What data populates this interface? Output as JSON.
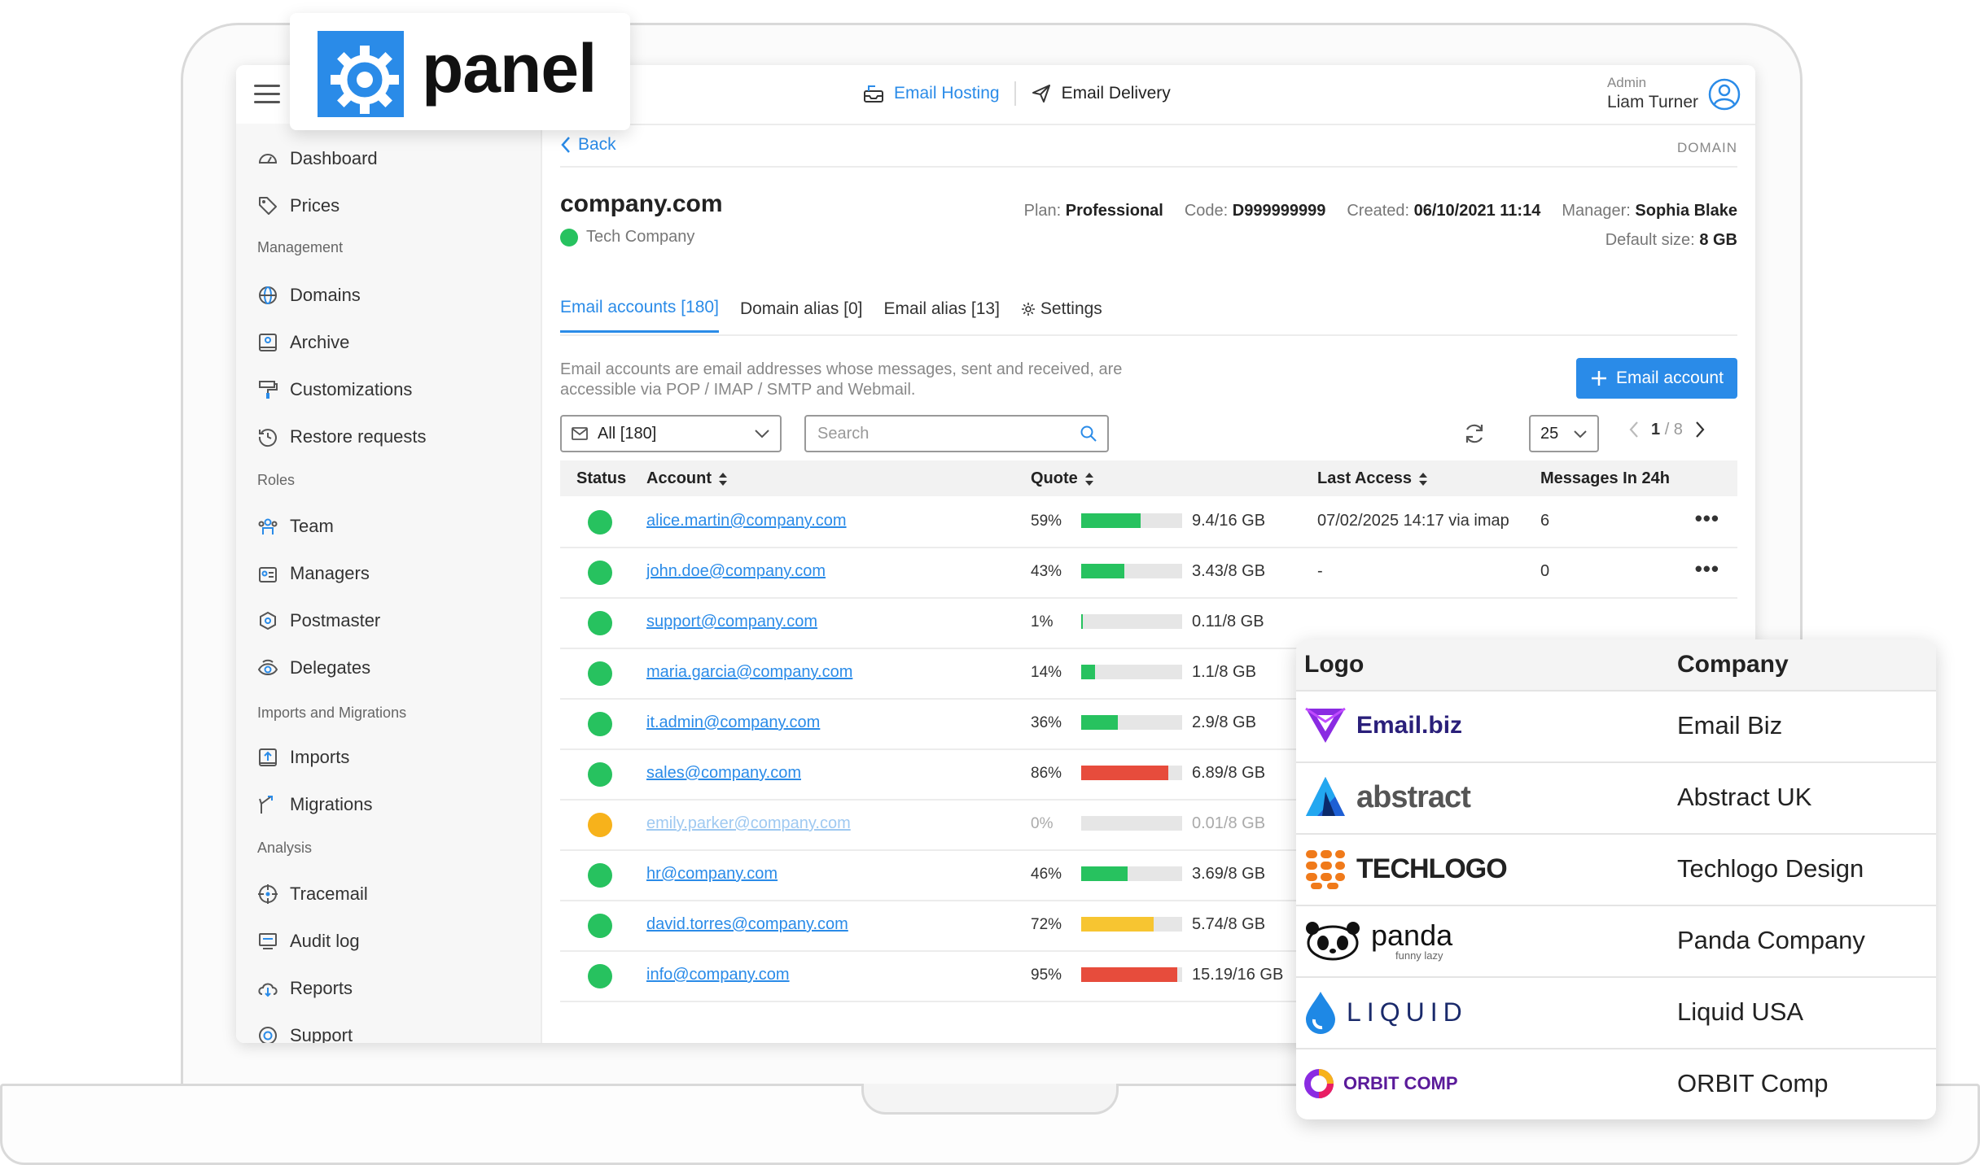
{
  "brand": {
    "logo_text": "panel"
  },
  "topbar": {
    "tabs": [
      {
        "label": "Email Hosting",
        "icon": "inbox-tray-icon",
        "active": true
      },
      {
        "label": "Email Delivery",
        "icon": "paper-plane-icon",
        "active": false
      }
    ],
    "user": {
      "role": "Admin",
      "name": "Liam Turner"
    }
  },
  "sidebar": {
    "items_top": [
      {
        "label": "Dashboard",
        "icon": "gauge-icon"
      },
      {
        "label": "Prices",
        "icon": "price-tag-icon"
      }
    ],
    "sections": [
      {
        "title": "Management",
        "items": [
          {
            "label": "Domains",
            "icon": "globe-icon"
          },
          {
            "label": "Archive",
            "icon": "archive-icon"
          },
          {
            "label": "Customizations",
            "icon": "paint-roller-icon"
          },
          {
            "label": "Restore requests",
            "icon": "history-icon"
          }
        ]
      },
      {
        "title": "Roles",
        "items": [
          {
            "label": "Team",
            "icon": "team-icon"
          },
          {
            "label": "Managers",
            "icon": "id-card-icon"
          },
          {
            "label": "Postmaster",
            "icon": "hexagon-icon"
          },
          {
            "label": "Delegates",
            "icon": "eye-icon"
          }
        ]
      },
      {
        "title": "Imports and Migrations",
        "items": [
          {
            "label": "Imports",
            "icon": "import-icon"
          },
          {
            "label": "Migrations",
            "icon": "migration-icon"
          }
        ]
      },
      {
        "title": "Analysis",
        "items": [
          {
            "label": "Tracemail",
            "icon": "target-icon"
          },
          {
            "label": "Audit log",
            "icon": "monitor-icon"
          },
          {
            "label": "Reports",
            "icon": "cloud-download-icon"
          },
          {
            "label": "Support",
            "icon": "lifebuoy-icon"
          }
        ]
      }
    ]
  },
  "main": {
    "back_label": "Back",
    "section_tag": "DOMAIN",
    "domain": "company.com",
    "company": "Tech Company",
    "meta": {
      "plan_label": "Plan:",
      "plan": "Professional",
      "code_label": "Code:",
      "code": "D999999999",
      "created_label": "Created:",
      "created": "06/10/2021 11:14",
      "manager_label": "Manager:",
      "manager": "Sophia Blake",
      "size_label": "Default size:",
      "size": "8 GB"
    },
    "tabs": [
      {
        "label": "Email accounts [180]",
        "active": true
      },
      {
        "label": "Domain alias [0]",
        "active": false
      },
      {
        "label": "Email alias [13]",
        "active": false
      },
      {
        "label": "Settings",
        "active": false,
        "icon": "gear-icon"
      }
    ],
    "description": "Email accounts are email addresses whose messages, sent and received, are accessible via POP / IMAP / SMTP and Webmail.",
    "add_button": "Email account",
    "filter": {
      "value": "All [180]"
    },
    "search": {
      "placeholder": "Search"
    },
    "per_page": "25",
    "pager": {
      "current": "1",
      "total": "/ 8"
    },
    "table": {
      "headers": [
        "Status",
        "Account",
        "Quote",
        "Last Access",
        "Messages In 24h"
      ],
      "rows": [
        {
          "status": "green",
          "account": "alice.martin@company.com",
          "pct": "59%",
          "quota": 0.59,
          "bar": "green",
          "size": "9.4/16 GB",
          "last": "07/02/2025 14:17 via imap",
          "msgs": "6",
          "more": "•••"
        },
        {
          "status": "green",
          "account": "john.doe@company.com",
          "pct": "43%",
          "quota": 0.43,
          "bar": "green",
          "size": "3.43/8 GB",
          "last": "-",
          "msgs": "0",
          "more": "•••"
        },
        {
          "status": "green",
          "account": "support@company.com",
          "pct": "1%",
          "quota": 0.01,
          "bar": "green",
          "size": "0.11/8 GB",
          "last": "",
          "msgs": "",
          "more": ""
        },
        {
          "status": "green",
          "account": "maria.garcia@company.com",
          "pct": "14%",
          "quota": 0.14,
          "bar": "green",
          "size": "1.1/8 GB",
          "last": "",
          "msgs": "",
          "more": ""
        },
        {
          "status": "green",
          "account": "it.admin@company.com",
          "pct": "36%",
          "quota": 0.36,
          "bar": "green",
          "size": "2.9/8 GB",
          "last": "",
          "msgs": "",
          "more": ""
        },
        {
          "status": "green",
          "account": "sales@company.com",
          "pct": "86%",
          "quota": 0.86,
          "bar": "red",
          "size": "6.89/8 GB",
          "last": "",
          "msgs": "",
          "more": ""
        },
        {
          "status": "orange",
          "account": "emily.parker@company.com",
          "pct": "0%",
          "quota": 0.0,
          "bar": "green",
          "size": "0.01/8 GB",
          "last": "",
          "msgs": "",
          "more": "",
          "muted": true
        },
        {
          "status": "green",
          "account": "hr@company.com",
          "pct": "46%",
          "quota": 0.46,
          "bar": "green",
          "size": "3.69/8 GB",
          "last": "",
          "msgs": "",
          "more": ""
        },
        {
          "status": "green",
          "account": "david.torres@company.com",
          "pct": "72%",
          "quota": 0.72,
          "bar": "yellow",
          "size": "5.74/8 GB",
          "last": "",
          "msgs": "",
          "more": ""
        },
        {
          "status": "green",
          "account": "info@company.com",
          "pct": "95%",
          "quota": 0.95,
          "bar": "red",
          "size": "15.19/16 GB",
          "last": "",
          "msgs": "",
          "more": ""
        }
      ]
    }
  },
  "companies": {
    "headers": [
      "Logo",
      "Company"
    ],
    "rows": [
      {
        "logo_text": "Email.biz",
        "name": "Email Biz",
        "icon": "email-biz-logo"
      },
      {
        "logo_text": "abstract",
        "name": "Abstract UK",
        "icon": "abstract-logo"
      },
      {
        "logo_text": "TECHLOGO",
        "name": "Techlogo Design",
        "icon": "techlogo-logo"
      },
      {
        "logo_text": "panda",
        "logo_sub": "funny lazy",
        "name": "Panda Company",
        "icon": "panda-logo"
      },
      {
        "logo_text": "LIQUID",
        "name": "Liquid USA",
        "icon": "liquid-logo"
      },
      {
        "logo_text": "ORBIT COMP",
        "name": "ORBIT Comp",
        "icon": "orbit-logo"
      }
    ]
  },
  "colors": {
    "accent": "#2a8be8",
    "green": "#27c25f",
    "orange": "#f7b21b",
    "red": "#e74c3c",
    "yellow": "#f7c531"
  }
}
